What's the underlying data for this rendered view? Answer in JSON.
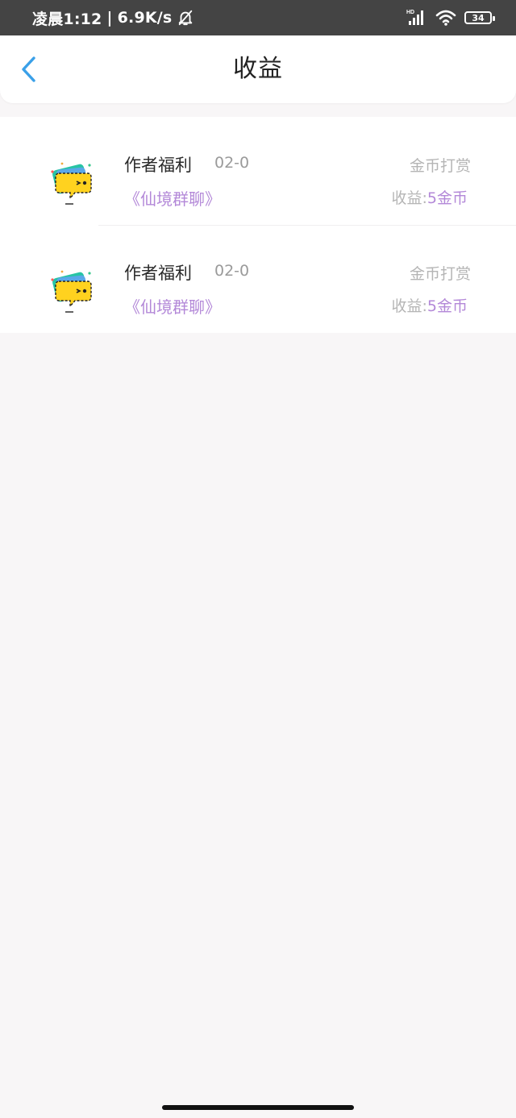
{
  "status_bar": {
    "time": "凌晨1:12",
    "network_speed": "6.9K/s",
    "separator": "|",
    "signal_label": "HD",
    "battery_level": "34",
    "icons": [
      "bell-off-icon",
      "signal-icon",
      "wifi-icon",
      "battery-icon"
    ]
  },
  "header": {
    "title": "收益",
    "back_icon": "chevron-left-icon"
  },
  "accent_colors": {
    "back_arrow": "#3aa0e8",
    "purple": "#b388d8",
    "gray_text": "#b5b5b5"
  },
  "records": [
    {
      "title": "作者福利",
      "date": "02-0",
      "book": "《仙境群聊》",
      "type": "金币打赏",
      "income_label": "收益:",
      "income_value": "5金币",
      "avatar": "chat-bubble-avatar"
    },
    {
      "title": "作者福利",
      "date": "02-0",
      "book": "《仙境群聊》",
      "type": "金币打赏",
      "income_label": "收益:",
      "income_value": "5金币",
      "avatar": "chat-bubble-avatar"
    }
  ]
}
